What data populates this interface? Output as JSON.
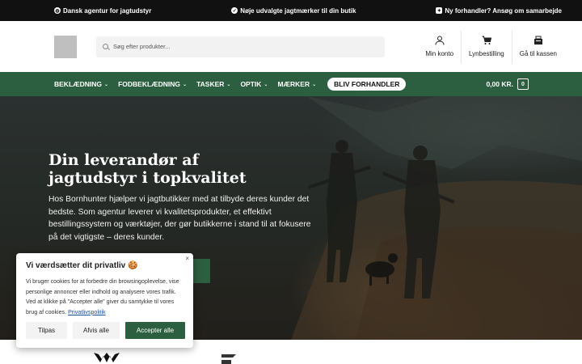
{
  "topbar": {
    "messages": [
      {
        "icon": "globe-icon",
        "text": "Dansk agentur for jagtudstyr"
      },
      {
        "icon": "check-circle-icon",
        "text": "Nøje udvalgte jagtmærker til din butik"
      },
      {
        "icon": "handshake-icon",
        "text": "Ny forhandler? Ansøg om samarbejde"
      }
    ]
  },
  "header": {
    "search_placeholder": "Søg efter produkter...",
    "actions": [
      {
        "icon": "user-icon",
        "label": "Min konto"
      },
      {
        "icon": "cart-icon",
        "label": "Lynbestilling"
      },
      {
        "icon": "checkout-icon",
        "label": "Gå til kassen"
      }
    ]
  },
  "nav": {
    "items": [
      "BEKLÆDNING",
      "FODBEKLÆDNING",
      "TASKER",
      "OPTIK",
      "MÆRKER"
    ],
    "cta": "BLIV FORHANDLER",
    "cart_total": "0,00 KR.",
    "cart_count": "0"
  },
  "hero": {
    "title_line1": "Din leverandør af",
    "title_line2": "jagtudstyr i topkvalitet",
    "text": "Hos Bornhunter hjælper vi jagtbutikker med at tilbyde deres kunder det bedste. Som agentur leverer vi kvalitetsprodukter, et effektivt bestillingssystem og værktøjer, der gør butikkerne i stand til at fokusere på det vigtigste – deres kunder."
  },
  "cookie": {
    "title": "Vi værdsætter dit privatliv 🍪",
    "body": "Vi bruger cookies for at forbedre din browsingoplevelse, vise personlige annoncer eller indhold og analysere vores trafik. Ved at klikke på \"Accepter alle\" giver du samtykke til vores brug af cookies.",
    "link": "Privatlivspolitik",
    "close": "×",
    "buttons": {
      "customize": "Tilpas",
      "reject": "Afvis alle",
      "accept": "Accepter alle"
    }
  },
  "colors": {
    "brand_green": "#2b5f3f",
    "topbar_bg": "#111111"
  }
}
